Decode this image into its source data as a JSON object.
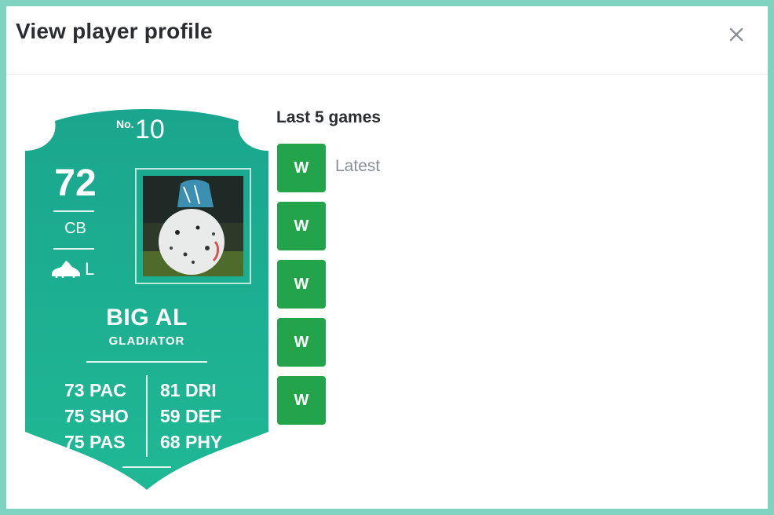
{
  "dialog": {
    "title": "View player profile",
    "close_icon": "close-icon"
  },
  "card": {
    "number_label": "No.",
    "number": "10",
    "rating": "72",
    "position": "CB",
    "foot_icon": "boot-icon",
    "foot": "L",
    "name": "BIG AL",
    "club": "GLADIATOR",
    "stats_left": [
      "73 PAC",
      "75 SHO",
      "75 PAS"
    ],
    "stats_right": [
      "81 DRI",
      "59 DEF",
      "68 PHY"
    ],
    "colors": {
      "card_top": "#1aa68e",
      "card_bottom": "#1fb894"
    }
  },
  "games": {
    "title": "Last 5 games",
    "results": [
      "W",
      "W",
      "W",
      "W",
      "W"
    ],
    "latest_label": "Latest",
    "win_color": "#24a44a"
  }
}
